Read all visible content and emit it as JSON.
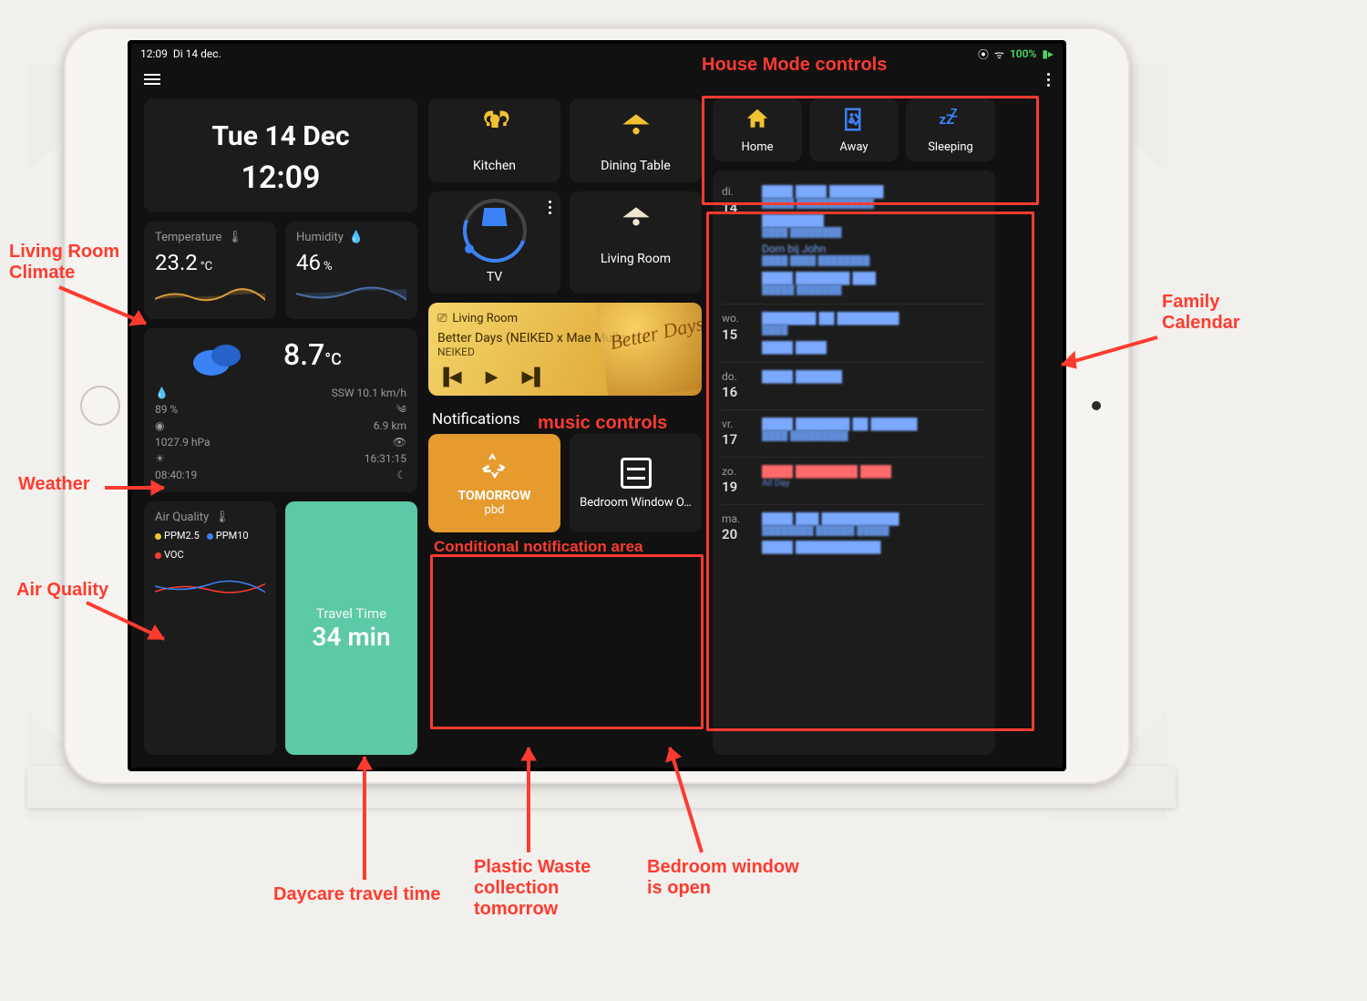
{
  "statusbar": {
    "time": "12:09",
    "date": "Di 14 dec.",
    "battery": "100%"
  },
  "header": {
    "date": "Tue 14 Dec",
    "time": "12:09"
  },
  "climate": {
    "temp_label": "Temperature",
    "temp": "23.2",
    "temp_unit": "°C",
    "hum_label": "Humidity",
    "hum": "46",
    "hum_unit": "%"
  },
  "weather": {
    "temp": "8.7",
    "temp_unit": "°C",
    "humidity": "89 %",
    "pressure": "1027.9 hPa",
    "sunrise": "08:40:19",
    "wind": "SSW 10.1 km/h",
    "visibility": "6.9 km",
    "sunset": "16:31:15"
  },
  "airquality": {
    "title": "Air Quality",
    "legend": [
      [
        "#f1c232",
        "PPM2.5"
      ],
      [
        "#3b82f6",
        "PPM10"
      ],
      [
        "#ff3b30",
        "VOC"
      ]
    ]
  },
  "travel": {
    "label": "Travel Time",
    "value": "34 min"
  },
  "lights": {
    "kitchen": "Kitchen",
    "dining": "Dining Table",
    "tv": "TV",
    "living": "Living Room"
  },
  "music": {
    "cast": "Living Room",
    "title": "Better Days (NEIKED x Mae Muller x P…",
    "artist": "NEIKED"
  },
  "notifications": {
    "title": "Notifications",
    "recycle_line1": "TOMORROW",
    "recycle_line2": "pbd",
    "window": "Bedroom Window O…"
  },
  "modes": {
    "home": "Home",
    "away": "Away",
    "sleep": "Sleeping"
  },
  "calendar": [
    {
      "dow": "di.",
      "day": "14",
      "items": [
        {
          "t": "████ ████ ███████",
          "sub": "█████ ████████████"
        },
        {
          "t": "████████",
          "sub": "████ ████████"
        },
        {
          "t": "Dom bij John",
          "sub": "████ ████ ████████"
        },
        {
          "t": "████ ███████ ███",
          "sub": "█████ ███████"
        }
      ]
    },
    {
      "dow": "wo.",
      "day": "15",
      "items": [
        {
          "t": "███████ ██ ████████",
          "sub": "████"
        },
        {
          "t": "████ ████",
          "sub": ""
        }
      ]
    },
    {
      "dow": "do.",
      "day": "16",
      "items": [
        {
          "t": "████ ██████",
          "sub": ""
        }
      ]
    },
    {
      "dow": "vr.",
      "day": "17",
      "items": [
        {
          "t": "████ ███████ ██ ██████",
          "sub": "████ █████████"
        }
      ]
    },
    {
      "dow": "zo.",
      "day": "19",
      "items": [
        {
          "t": "████ ████████ ████",
          "sub": "All Day",
          "cls": "red"
        }
      ]
    },
    {
      "dow": "ma.",
      "day": "20",
      "items": [
        {
          "t": "████ ███ ██████████",
          "sub": "████████ ██████ █████"
        },
        {
          "t": "████ ███████████",
          "sub": ""
        }
      ]
    }
  ],
  "annotations": {
    "house_mode": "House Mode controls",
    "family_cal": "Family\nCalendar",
    "lr_climate": "Living Room\nClimate",
    "weather": "Weather",
    "air_quality": "Air Quality",
    "music": "music controls",
    "cond_notif": "Conditional notification area",
    "daycare": "Daycare travel time",
    "plastic": "Plastic Waste\ncollection\ntomorrow",
    "bedroom": "Bedroom window\nis open"
  }
}
